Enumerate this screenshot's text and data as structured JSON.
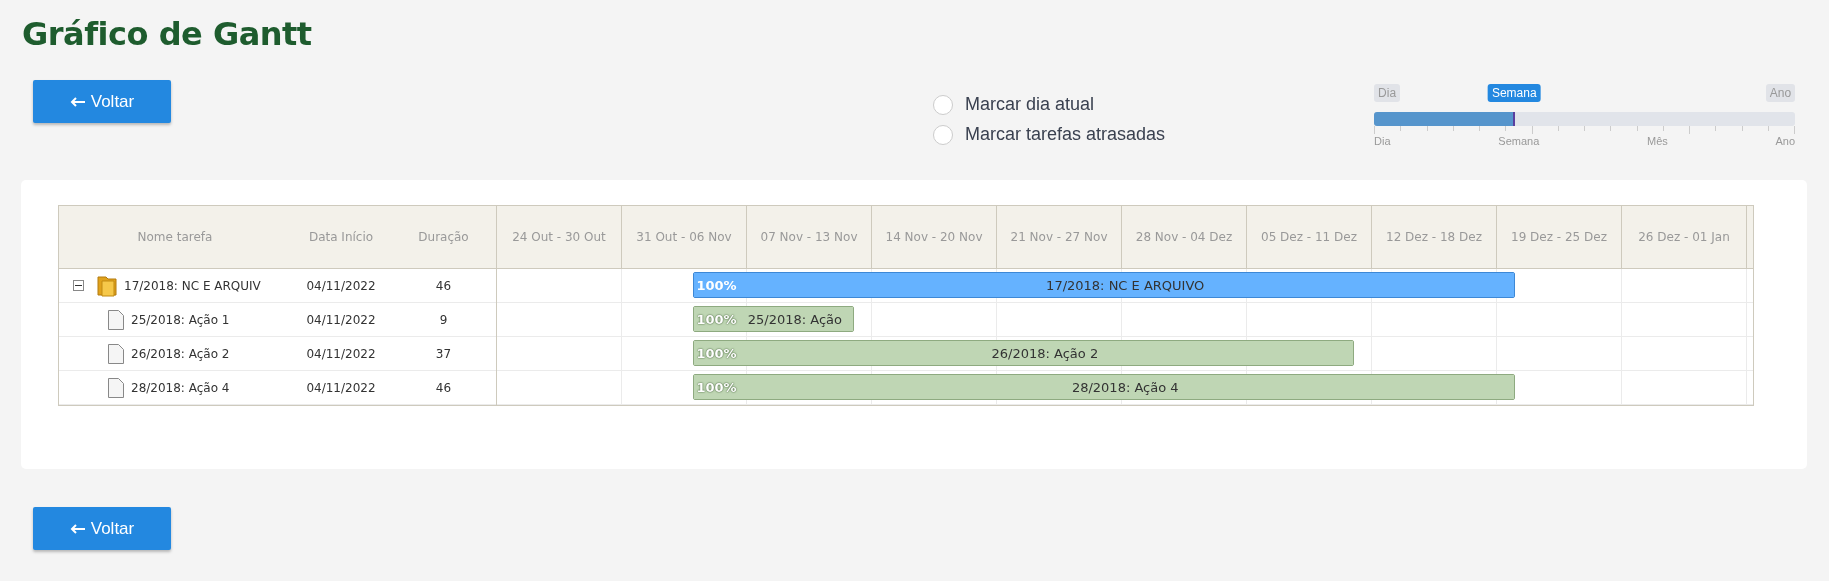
{
  "title": "Gráfico de Gantt",
  "back_button_top": {
    "label": "Voltar"
  },
  "options": [
    {
      "label": "Marcar dia atual",
      "checked": false
    },
    {
      "label": "Marcar tarefas atrasadas",
      "checked": false
    }
  ],
  "zoom_slider": {
    "min_label": "Dia",
    "value_label": "Semana",
    "max_label": "Ano",
    "level": 0.333,
    "scale_labels": [
      "Dia",
      "Semana",
      "Mês",
      "Ano"
    ]
  },
  "gantt": {
    "columns": [
      "Nome tarefa",
      "Data Início",
      "Duração"
    ],
    "timeline": [
      "24 Out - 30 Out",
      "31 Out - 06 Nov",
      "07 Nov - 13 Nov",
      "14 Nov - 20 Nov",
      "21 Nov - 27 Nov",
      "28 Nov - 04 Dez",
      "05 Dez - 11 Dez",
      "12 Dez - 18 Dez",
      "19 Dez - 25 Dez",
      "26 Dez - 01 Jan"
    ],
    "tasks": [
      {
        "kind": "project",
        "name": "17/2018: NC E ARQUIV",
        "start": "04/11/2022",
        "duration": "46",
        "expanded": true,
        "bar_progress": "100%",
        "bar_label": "17/2018: NC E ARQUIVO",
        "level": 1,
        "children": [
          {
            "kind": "task",
            "name": "25/2018: Ação 1",
            "start": "04/11/2022",
            "duration": "9",
            "bar_progress": "100%",
            "bar_label": "25/2018: Ação",
            "level": 1
          },
          {
            "kind": "task",
            "name": "26/2018: Ação 2",
            "start": "04/11/2022",
            "duration": "37",
            "bar_progress": "100%",
            "bar_label": "26/2018: Ação 2",
            "level": 1
          },
          {
            "kind": "task",
            "name": "28/2018: Ação 4",
            "start": "04/11/2022",
            "duration": "46",
            "bar_progress": "100%",
            "bar_label": "28/2018: Ação 4",
            "level": 1
          }
        ]
      }
    ]
  },
  "back_button_bottom": {
    "label": "Voltar"
  }
}
